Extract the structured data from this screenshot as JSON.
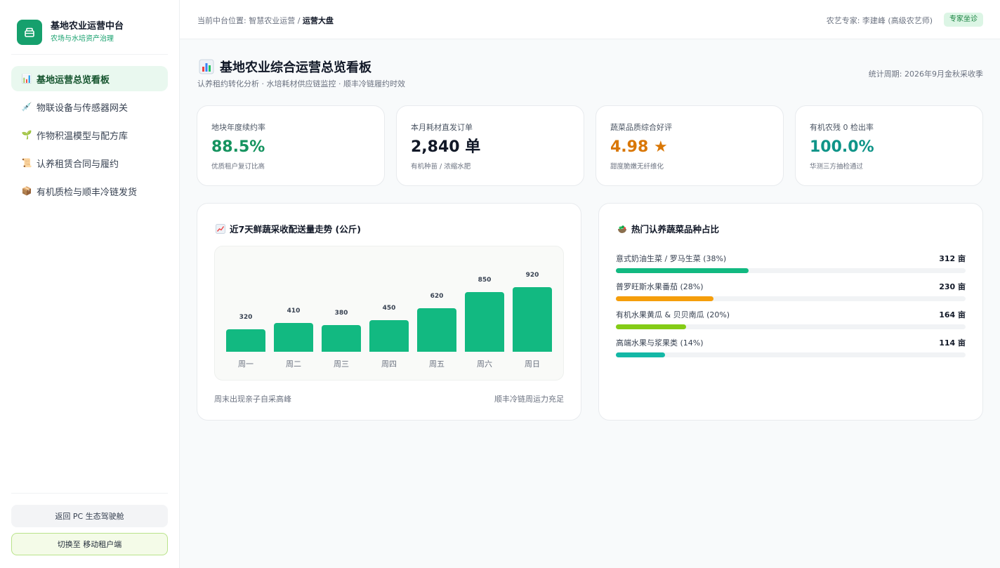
{
  "brand": {
    "title": "基地农业运营中台",
    "subtitle": "农场与水培资产治理"
  },
  "sidebar": {
    "items": [
      {
        "icon": "📊",
        "label": "基地运营总览看板",
        "active": true
      },
      {
        "icon": "💉",
        "label": "物联设备与传感器网关",
        "active": false
      },
      {
        "icon": "🌱",
        "label": "作物积温模型与配方库",
        "active": false
      },
      {
        "icon": "📜",
        "label": "认养租赁合同与履约",
        "active": false
      },
      {
        "icon": "📦",
        "label": "有机质检与顺丰冷链发货",
        "active": false
      }
    ],
    "back_pc_label": "返回 PC 生态驾驶舱",
    "switch_mobile_label": "切换至 移动租户端"
  },
  "topbar": {
    "crumb_prefix": "当前中台位置: 智慧农业运营 / ",
    "crumb_current": "运营大盘",
    "expert": "农艺专家: 李建峰 (高级农艺师)",
    "badge": "专家坐诊"
  },
  "header": {
    "title": "基地农业综合运营总览看板",
    "subtitle": "认养租约转化分析 · 水培耗材供应链监控 · 顺丰冷链履约时效",
    "period": "统计周期: 2026年9月金秋采收季"
  },
  "kpis": [
    {
      "label": "地块年度续约率",
      "value": "88.5%",
      "desc": "优质租户复订比高",
      "color": "#15935f"
    },
    {
      "label": "本月耗材直发订单",
      "value": "2,840 单",
      "desc": "有机种苗 / 浓缩水肥",
      "color": "#111827"
    },
    {
      "label": "蔬菜品质综合好评",
      "value": "4.98 ★",
      "desc": "甜度脆嫩无纤维化",
      "color": "#d97706"
    },
    {
      "label": "有机农残 0 检出率",
      "value": "100.0%",
      "desc": "华测三方抽检通过",
      "color": "#0f9488"
    }
  ],
  "trend_panel": {
    "title": "近7天鲜蔬采收配送量走势 (公斤)",
    "foot_left": "周末出现亲子自采高峰",
    "foot_right": "顺丰冷链周运力充足"
  },
  "chart_data": {
    "type": "bar",
    "title": "近7天鲜蔬采收配送量走势 (公斤)",
    "categories": [
      "周一",
      "周二",
      "周三",
      "周四",
      "周五",
      "周六",
      "周日"
    ],
    "values": [
      320,
      410,
      380,
      450,
      620,
      850,
      920
    ],
    "ylim": [
      0,
      920
    ],
    "grid": false,
    "bar_color": "#12b981"
  },
  "share_panel": {
    "title": "热门认养蔬菜品种占比",
    "rows": [
      {
        "label": "意式奶油生菜 / 罗马生菜 (38%)",
        "value": "312 亩",
        "pct": 38,
        "color": "#12b981"
      },
      {
        "label": "普罗旺斯水果番茄 (28%)",
        "value": "230 亩",
        "pct": 28,
        "color": "#f59e0b"
      },
      {
        "label": "有机水果黄瓜 & 贝贝南瓜 (20%)",
        "value": "164 亩",
        "pct": 20,
        "color": "#84cc16"
      },
      {
        "label": "高端水果与浆果类 (14%)",
        "value": "114 亩",
        "pct": 14,
        "color": "#14b8a6"
      }
    ]
  }
}
